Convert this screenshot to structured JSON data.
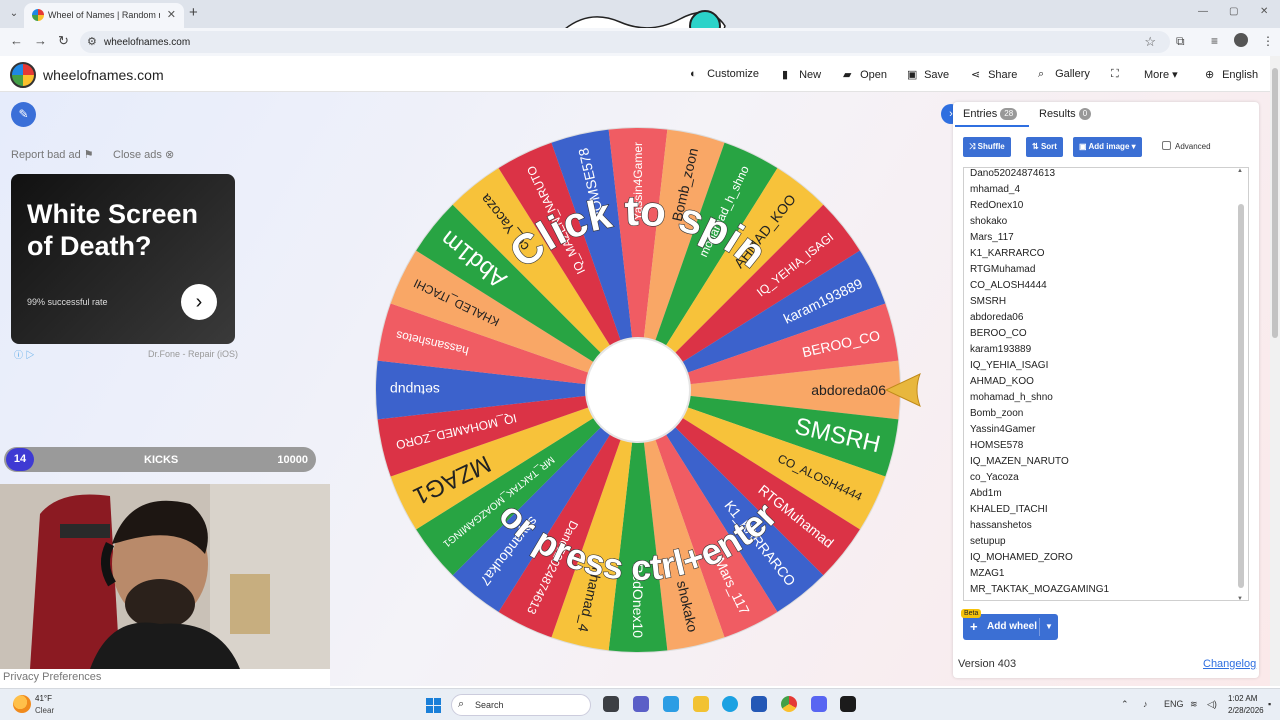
{
  "browser": {
    "tab_title": "Wheel of Names | Random nam",
    "url": "wheelofnames.com"
  },
  "header": {
    "brand": "wheelofnames.com",
    "menu": {
      "customize": "Customize",
      "new": "New",
      "open": "Open",
      "save": "Save",
      "share": "Share",
      "gallery": "Gallery",
      "more": "More",
      "language": "English"
    }
  },
  "ad": {
    "report": "Report bad ad",
    "close": "Close ads",
    "headline": "White Screen of Death?",
    "subtext": "99% successful rate",
    "source": "Dr.Fone - Repair (iOS)"
  },
  "kicks_bar": {
    "count": "14",
    "label": "KICKS",
    "goal": "10000"
  },
  "wheel": {
    "overlay_top": "Click to spin",
    "overlay_bottom": "or press ctrl+enter",
    "colors": [
      "#c53143",
      "#e7464f",
      "#f9c33a",
      "#40a941",
      "#3d65cc"
    ],
    "segments": [
      {
        "label": "abdoreda06",
        "color": "#f9a766"
      },
      {
        "label": "SMSRH",
        "color": "#28a443"
      },
      {
        "label": "CO_ALOSH4444",
        "color": "#f7c23a"
      },
      {
        "label": "RTGMuhamad",
        "color": "#db3346"
      },
      {
        "label": "K1_KARRARCO",
        "color": "#3c62cc"
      },
      {
        "label": "Mars_117",
        "color": "#f05c63"
      },
      {
        "label": "shokako",
        "color": "#f9a766"
      },
      {
        "label": "RedOnex10",
        "color": "#28a443"
      },
      {
        "label": "mhamad_4",
        "color": "#f7c23a"
      },
      {
        "label": "Dano52024874613",
        "color": "#db3346"
      },
      {
        "label": "soyandouka7",
        "color": "#3c62cc"
      },
      {
        "label": "MR_TAKTAK_MOAZGAMING1",
        "color": "#28a443"
      },
      {
        "label": "MZAG1",
        "color": "#f7c23a"
      },
      {
        "label": "IQ_MOHAMED_ZORO",
        "color": "#db3346"
      },
      {
        "label": "setupup",
        "color": "#3c62cc"
      },
      {
        "label": "hassanshetos",
        "color": "#f05c63"
      },
      {
        "label": "KHALED_ITACHI",
        "color": "#f9a766"
      },
      {
        "label": "Abd1m",
        "color": "#28a443"
      },
      {
        "label": "co_Yacoza",
        "color": "#f7c23a"
      },
      {
        "label": "IQ_MAZEN_NARUTO",
        "color": "#db3346"
      },
      {
        "label": "HOMSE578",
        "color": "#3c62cc"
      },
      {
        "label": "Yassin4Gamer",
        "color": "#f05c63"
      },
      {
        "label": "Bomb_zoon",
        "color": "#f9a766"
      },
      {
        "label": "mohamad_h_shno",
        "color": "#28a443"
      },
      {
        "label": "AHMAD_KOO",
        "color": "#f7c23a"
      },
      {
        "label": "IQ_YEHIA_ISAGI",
        "color": "#db3346"
      },
      {
        "label": "karam193889",
        "color": "#3c62cc"
      },
      {
        "label": "BEROO_CO",
        "color": "#f05c63"
      }
    ]
  },
  "panel": {
    "tab_entries": "Entries",
    "entries_count": "28",
    "tab_results": "Results",
    "results_count": "0",
    "shuffle": "Shuffle",
    "sort": "Sort",
    "add_image": "Add image",
    "advanced": "Advanced",
    "entries": [
      "Dano52024874613",
      "mhamad_4",
      "RedOnex10",
      "shokako",
      "Mars_117",
      "K1_KARRARCO",
      "RTGMuhamad",
      "CO_ALOSH4444",
      "SMSRH",
      "abdoreda06",
      "BEROO_CO",
      "karam193889",
      "IQ_YEHIA_ISAGI",
      "AHMAD_KOO",
      "mohamad_h_shno",
      "Bomb_zoon",
      "Yassin4Gamer",
      "HOMSE578",
      "IQ_MAZEN_NARUTO",
      "co_Yacoza",
      "Abd1m",
      "KHALED_ITACHI",
      "hassanshetos",
      "setupup",
      "IQ_MOHAMED_ZORO",
      "MZAG1",
      "MR_TAKTAK_MOAZGAMING1"
    ],
    "beta": "Beta",
    "add_wheel": "Add wheel",
    "version": "Version 403",
    "changelog": "Changelog"
  },
  "privacy": "Privacy Preferences",
  "taskbar": {
    "temp": "41°F",
    "condition": "Clear",
    "search": "Search",
    "lang": "ENG",
    "time": "1:02 AM",
    "date": "2/28/2026"
  }
}
